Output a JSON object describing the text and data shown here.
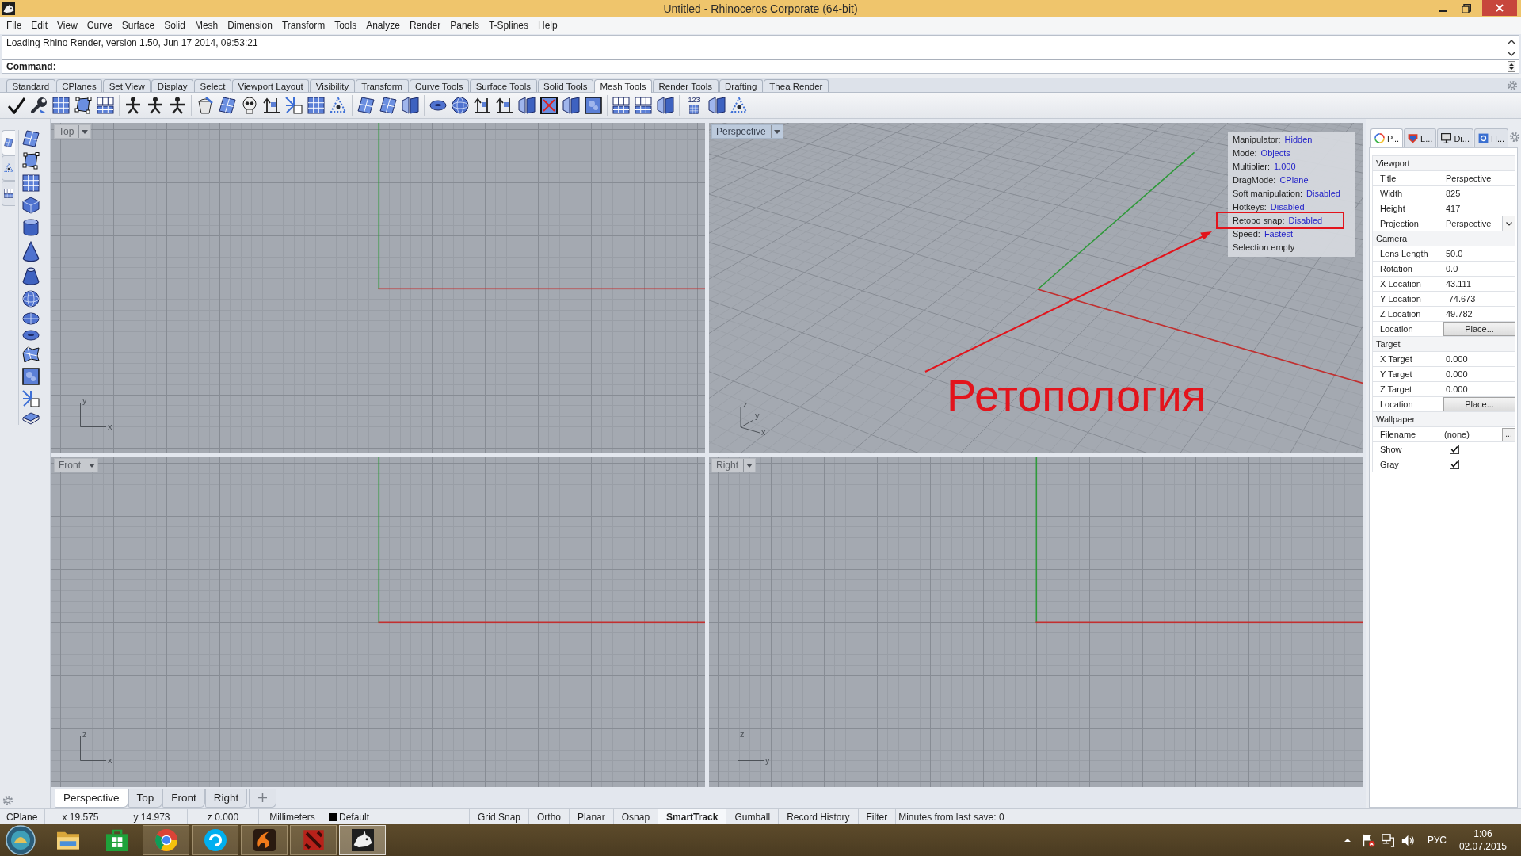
{
  "window": {
    "title": "Untitled - Rhinoceros Corporate (64-bit)"
  },
  "menu": [
    "File",
    "Edit",
    "View",
    "Curve",
    "Surface",
    "Solid",
    "Mesh",
    "Dimension",
    "Transform",
    "Tools",
    "Analyze",
    "Render",
    "Panels",
    "T-Splines",
    "Help"
  ],
  "command": {
    "history": "Loading Rhino Render, version 1.50, Jun 17 2014, 09:53:21",
    "prompt": "Command:"
  },
  "toolbar": {
    "tabs": [
      {
        "label": "Standard",
        "selected": false
      },
      {
        "label": "CPlanes",
        "selected": false
      },
      {
        "label": "Set View",
        "selected": false
      },
      {
        "label": "Display",
        "selected": false
      },
      {
        "label": "Select",
        "selected": false
      },
      {
        "label": "Viewport Layout",
        "selected": false
      },
      {
        "label": "Visibility",
        "selected": false
      },
      {
        "label": "Transform",
        "selected": false
      },
      {
        "label": "Curve Tools",
        "selected": false
      },
      {
        "label": "Surface Tools",
        "selected": false
      },
      {
        "label": "Solid Tools",
        "selected": false
      },
      {
        "label": "Mesh Tools",
        "selected": true
      },
      {
        "label": "Render Tools",
        "selected": false
      },
      {
        "label": "Drafting",
        "selected": false
      },
      {
        "label": "Thea Render",
        "selected": false
      }
    ],
    "numbering_button": "123"
  },
  "side_toolbar": {
    "tabs": [
      {
        "selected": true
      },
      {
        "selected": false
      },
      {
        "selected": false
      }
    ]
  },
  "viewports": [
    {
      "kind": "ortho",
      "title": "Top",
      "active": false,
      "axis_labels": [
        "y",
        "x"
      ]
    },
    {
      "kind": "perspective",
      "title": "Perspective",
      "active": true,
      "axis_labels": [
        "z",
        "y",
        "x"
      ],
      "overlay": {
        "items": [
          {
            "label": "Manipulator:",
            "value": "Hidden",
            "highlighted": false
          },
          {
            "label": "Mode:",
            "value": "Objects",
            "highlighted": false
          },
          {
            "label": "Multiplier:",
            "value": "1.000",
            "highlighted": false
          },
          {
            "label": "DragMode:",
            "value": "CPlane",
            "highlighted": false
          },
          {
            "label": "Soft manipulation:",
            "value": "Disabled",
            "highlighted": false
          },
          {
            "label": "Hotkeys:",
            "value": "Disabled",
            "highlighted": false
          },
          {
            "label": "Retopo snap:",
            "value": "Disabled",
            "highlighted": true
          },
          {
            "label": "Speed:",
            "value": "Fastest",
            "highlighted": false
          },
          {
            "label": "Selection empty",
            "highlighted": false
          }
        ]
      },
      "annotation": {
        "text": "Ретопология"
      }
    },
    {
      "kind": "ortho",
      "title": "Front",
      "active": false,
      "axis_labels": [
        "z",
        "x"
      ]
    },
    {
      "kind": "ortho",
      "title": "Right",
      "active": false,
      "axis_labels": [
        "z",
        "y"
      ]
    }
  ],
  "viewport_tabs": [
    {
      "label": "Perspective",
      "selected": true
    },
    {
      "label": "Top",
      "selected": false
    },
    {
      "label": "Front",
      "selected": false
    },
    {
      "label": "Right",
      "selected": false
    }
  ],
  "properties": {
    "tabs": [
      {
        "label": "P...",
        "selected": true
      },
      {
        "label": "L...",
        "selected": false
      },
      {
        "label": "Di...",
        "selected": false
      },
      {
        "label": "H...",
        "selected": false
      }
    ],
    "sections": [
      {
        "title": "Viewport",
        "rows": [
          {
            "kind": "text",
            "label": "Title",
            "value": "Perspective"
          },
          {
            "kind": "text",
            "label": "Width",
            "value": "825"
          },
          {
            "kind": "text",
            "label": "Height",
            "value": "417"
          },
          {
            "kind": "dropdown",
            "label": "Projection",
            "value": "Perspective"
          }
        ]
      },
      {
        "title": "Camera",
        "rows": [
          {
            "kind": "text",
            "label": "Lens Length",
            "value": "50.0"
          },
          {
            "kind": "text",
            "label": "Rotation",
            "value": "0.0"
          },
          {
            "kind": "text",
            "label": "X Location",
            "value": "43.111"
          },
          {
            "kind": "text",
            "label": "Y Location",
            "value": "-74.673"
          },
          {
            "kind": "text",
            "label": "Z Location",
            "value": "49.782"
          },
          {
            "kind": "button",
            "label": "Location",
            "value": "Place..."
          }
        ]
      },
      {
        "title": "Target",
        "rows": [
          {
            "kind": "text",
            "label": "X Target",
            "value": "0.000"
          },
          {
            "kind": "text",
            "label": "Y Target",
            "value": "0.000"
          },
          {
            "kind": "text",
            "label": "Z Target",
            "value": "0.000"
          },
          {
            "kind": "button",
            "label": "Location",
            "value": "Place..."
          }
        ]
      },
      {
        "title": "Wallpaper",
        "rows": [
          {
            "kind": "file",
            "label": "Filename",
            "value": "(none)",
            "button": "..."
          },
          {
            "kind": "checkbox",
            "label": "Show",
            "checked": true
          },
          {
            "kind": "checkbox",
            "label": "Gray",
            "checked": true
          }
        ]
      }
    ]
  },
  "status_bar": {
    "cplane": "CPlane",
    "coords": [
      "x 19.575",
      "y 14.973",
      "z 0.000"
    ],
    "units": "Millimeters",
    "layer": {
      "name": "Default",
      "color": "#000000"
    },
    "toggles": [
      {
        "label": "Grid Snap",
        "on": false
      },
      {
        "label": "Ortho",
        "on": false
      },
      {
        "label": "Planar",
        "on": false
      },
      {
        "label": "Osnap",
        "on": false
      },
      {
        "label": "SmartTrack",
        "on": true
      },
      {
        "label": "Gumball",
        "on": false
      },
      {
        "label": "Record History",
        "on": false
      },
      {
        "label": "Filter",
        "on": false
      }
    ],
    "message": "Minutes from last save: 0"
  },
  "taskbar": {
    "apps": [
      {
        "running": false,
        "selected": false
      },
      {
        "running": false,
        "selected": false
      },
      {
        "running": true,
        "selected": false
      },
      {
        "running": true,
        "selected": false
      },
      {
        "running": true,
        "selected": false
      },
      {
        "running": true,
        "selected": false
      },
      {
        "running": true,
        "selected": true
      }
    ],
    "language": "РУС",
    "time": "1:06",
    "date": "02.07.2015"
  }
}
